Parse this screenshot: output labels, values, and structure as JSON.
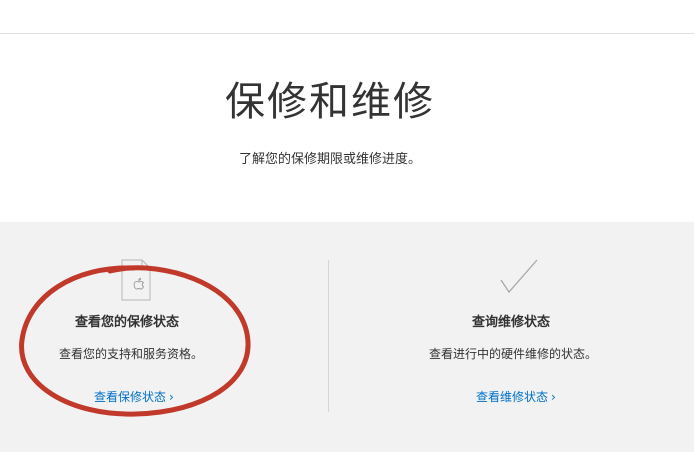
{
  "header": {
    "title": "保修和维修",
    "subtitle": "了解您的保修期限或维修进度。"
  },
  "cards": [
    {
      "icon": "document-apple-icon",
      "title": "查看您的保修状态",
      "description": "查看您的支持和服务资格。",
      "link_label": "查看保修状态",
      "link_chevron": "›"
    },
    {
      "icon": "checkmark-icon",
      "title": "查询维修状态",
      "description": "查看进行中的硬件维修的状态。",
      "link_label": "查看维修状态",
      "link_chevron": "›"
    }
  ],
  "annotation": {
    "color": "#c0392b"
  },
  "colors": {
    "link": "#0070c9",
    "panel_bg": "#f2f2f2",
    "text": "#333333"
  }
}
